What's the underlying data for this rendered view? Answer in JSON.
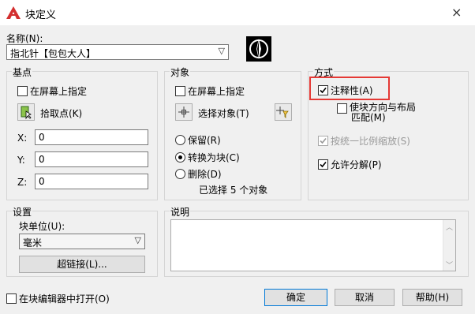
{
  "window": {
    "title": "块定义",
    "close": "×"
  },
  "name": {
    "label": "名称(N):",
    "value": "指北针【包包大人】"
  },
  "base_point": {
    "title": "基点",
    "specify_on_screen": "在屏幕上指定",
    "pick_point": "拾取点(K)",
    "x_label": "X:",
    "x_value": "0",
    "y_label": "Y:",
    "y_value": "0",
    "z_label": "Z:",
    "z_value": "0"
  },
  "objects": {
    "title": "对象",
    "specify_on_screen": "在屏幕上指定",
    "select_objects": "选择对象(T)",
    "retain": "保留(R)",
    "convert_to_block": "转换为块(C)",
    "delete": "删除(D)",
    "selected_count": "已选择 5 个对象"
  },
  "behavior": {
    "title": "方式",
    "annotative": "注释性(A)",
    "match_orientation_l1": "使块方向与布局",
    "match_orientation_l2": "匹配(M)",
    "scale_uniformly": "按统一比例缩放(S)",
    "allow_exploding": "允许分解(P)"
  },
  "settings": {
    "title": "设置",
    "block_unit_label": "块单位(U):",
    "block_unit_value": "毫米",
    "hyperlink": "超链接(L)..."
  },
  "description": {
    "title": "说明",
    "value": ""
  },
  "footer": {
    "open_in_editor": "在块编辑器中打开(O)",
    "ok": "确定",
    "cancel": "取消",
    "help": "帮助(H)"
  },
  "colors": {
    "accent_red": "#e53935",
    "title_icon_red": "#d32f2f",
    "default_border": "#0078d7"
  }
}
